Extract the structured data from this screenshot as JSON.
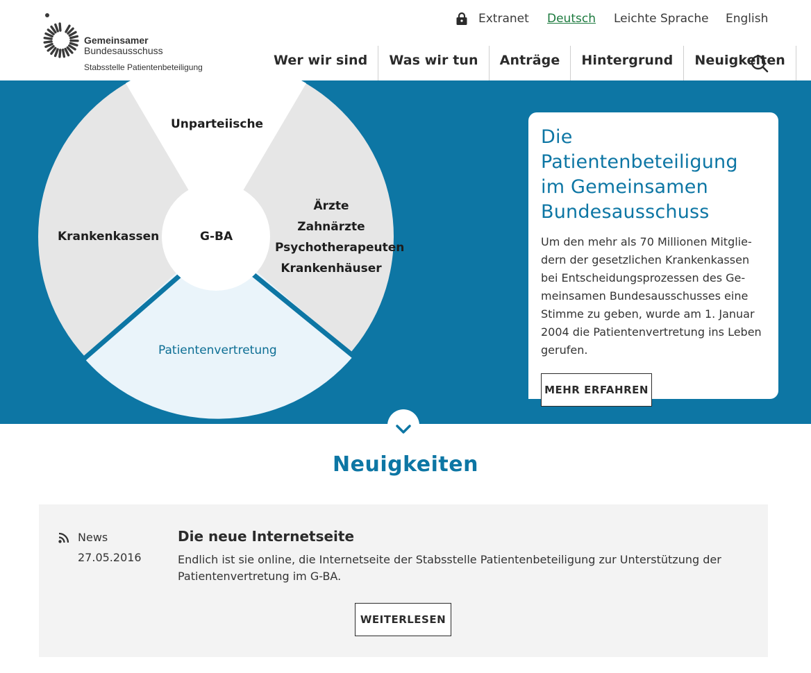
{
  "logo": {
    "title": "Gemeinsamer",
    "subtitle": "Bundesausschuss",
    "tagline": "Stabsstelle Patientenbeteiligung"
  },
  "utility_nav": {
    "extranet": "Extranet",
    "deutsch": "Deutsch",
    "leichte_sprache": "Leichte Sprache",
    "english": "English",
    "lock_icon": "lock-icon"
  },
  "main_nav": {
    "items": [
      {
        "label": "Wer wir sind"
      },
      {
        "label": "Was wir tun"
      },
      {
        "label": "Anträge"
      },
      {
        "label": "Hintergrund"
      },
      {
        "label": "Neuigkeiten"
      }
    ],
    "search_icon": "search-icon"
  },
  "hero": {
    "wheel": {
      "center": "G-BA",
      "segments": {
        "top": "Unparteiische",
        "left": "Krankenkassen",
        "right": [
          "Ärzte",
          "Zahnärzte",
          "Psychotherapeuten",
          "Krankenhäuser"
        ],
        "bottom": "Patientenvertretung"
      }
    },
    "card": {
      "title": "Die Patientenbeteiligung im Gemeinsamen Bundesausschuss",
      "text": "Um den mehr als 70 Millionen Mitglie-dern der gesetzlichen Krankenkassen bei Entscheidungsprozessen des Ge-meinsamen Bundesausschusses eine Stimme zu geben, wurde am 1. Januar 2004 die Patientenvertretung ins Leben gerufen.",
      "button": "MEHR ERFAHREN"
    },
    "scroll_icon": "chevron-down-icon"
  },
  "news": {
    "heading": "Neuigkeiten",
    "item": {
      "category": "News",
      "date": "27.05.2016",
      "title": "Die neue Internetseite",
      "text": "Endlich ist sie online, die Internetseite der Stabsstelle Patientenbeteiligung zur Unterstützung der Patientenvertretung im G-BA.",
      "button": "WEITERLESEN",
      "icon": "rss-icon"
    }
  },
  "colors": {
    "primary_blue": "#0d76a4",
    "segment_gray": "#e6e6e6",
    "segment_light_blue": "#eaf4fa",
    "link_green": "#1c7a3e",
    "news_bg": "#f3f3f3"
  }
}
